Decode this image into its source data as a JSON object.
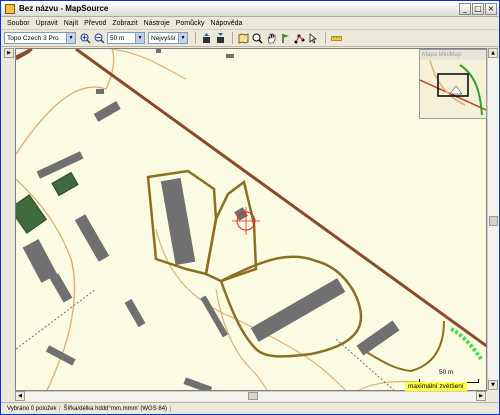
{
  "window": {
    "title": "Bez názvu - MapSource",
    "minimize": "_",
    "maximize": "□",
    "close": "×"
  },
  "menu": [
    "Soubor",
    "Úpravit",
    "Najít",
    "Převod",
    "Zobrazit",
    "Nástroje",
    "Pomůcky",
    "Nápověda"
  ],
  "toolbar": {
    "map_product": "Topo Czech 3 Pro",
    "zoom_level": "50 m",
    "detail_level": "Nejvyšší"
  },
  "minimap": {
    "title": "Mapa MiniMap"
  },
  "map": {
    "scale_label": "50 m",
    "max_zoom_label": "maximální zvětšení",
    "colors": {
      "background": "#FBFBE3",
      "building": "#707070",
      "path": "#D9B27A",
      "road": "#8B4A2B",
      "fence": "#8A7020",
      "forest": "#3F6B3F"
    }
  },
  "status": {
    "selected": "Vybráno 0 položek",
    "coords": "Šířka/délka hddd°mm.mmm' (WGS 84)"
  },
  "icons": [
    "zoom-in-icon",
    "zoom-out-icon",
    "send-to-device-icon",
    "receive-from-device-icon",
    "map-tool-icon",
    "zoom-tool-icon",
    "pan-tool-icon",
    "waypoint-tool-icon",
    "route-tool-icon",
    "select-tool-icon",
    "measure-tool-icon"
  ]
}
